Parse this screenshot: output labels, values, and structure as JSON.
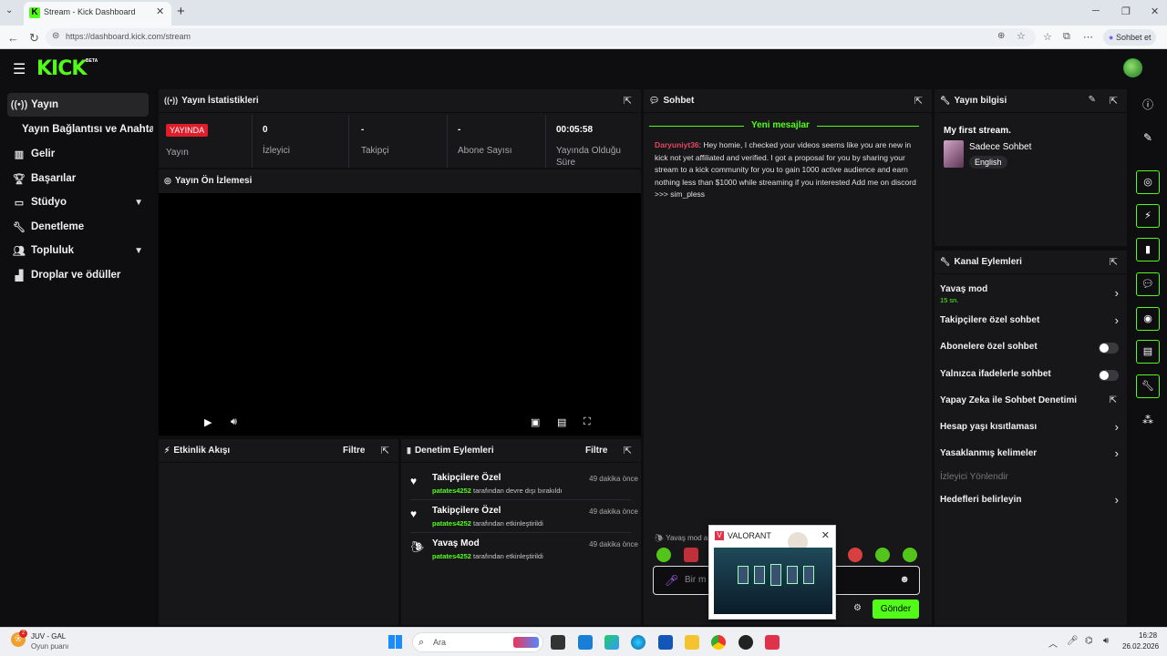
{
  "browser": {
    "tab_title": "Stream - Kick Dashboard",
    "url": "https://dashboard.kick.com/stream",
    "chat_button": "Sohbet et"
  },
  "header": {
    "logo": "KICK",
    "beta": "BETA"
  },
  "sidebar": {
    "items": [
      {
        "label": "Yayın",
        "icon": "broadcast-icon"
      },
      {
        "label": "Yayın Bağlantısı ve Anahtarı",
        "icon": ""
      },
      {
        "label": "Gelir",
        "icon": "chart-icon"
      },
      {
        "label": "Başarılar",
        "icon": "trophy-icon"
      },
      {
        "label": "Stüdyo",
        "icon": "studio-icon"
      },
      {
        "label": "Denetleme",
        "icon": "wrench-icon"
      },
      {
        "label": "Topluluk",
        "icon": "people-icon"
      },
      {
        "label": "Droplar ve ödüller",
        "icon": "gift-icon"
      }
    ]
  },
  "stats": {
    "title": "Yayın İstatistikleri",
    "live_badge": "YAYINDA",
    "cells": [
      {
        "value": "",
        "label": "Yayın"
      },
      {
        "value": "0",
        "label": "İzleyici"
      },
      {
        "value": "-",
        "label": "Takipçi"
      },
      {
        "value": "-",
        "label": "Abone Sayısı"
      },
      {
        "value": "00:05:58",
        "label": "Yayında Olduğu Süre"
      }
    ]
  },
  "preview": {
    "title": "Yayın Ön İzlemesi"
  },
  "activity": {
    "title": "Etkinlik Akışı",
    "filter": "Filtre"
  },
  "modactions": {
    "title": "Denetim Eylemleri",
    "filter": "Filtre",
    "items": [
      {
        "title": "Takipçilere Özel",
        "user": "patates4252",
        "desc": "tarafından devre dışı bırakıldı",
        "time": "49 dakika önce",
        "icon": "heart-icon"
      },
      {
        "title": "Takipçilere Özel",
        "user": "patates4252",
        "desc": "tarafından etkinleştirildi",
        "time": "49 dakika önce",
        "icon": "heart-icon"
      },
      {
        "title": "Yavaş Mod",
        "user": "patates4252",
        "desc": "tarafından etkinleştirildi",
        "time": "49 dakika önce",
        "icon": "snail-icon"
      }
    ]
  },
  "chat": {
    "title": "Sohbet",
    "new_messages": "Yeni mesajlar",
    "message_user": "Daryuniyt36",
    "message_text": ": Hey homie, I checked your videos seems like you are new in kick not yet affiliated and verified. I got a proposal for you by sharing your stream to a kick community for you to gain 1000 active audience and earn nothing less than $1000 while streaming if you interested Add me on discord >>> sim_pless",
    "slow_mode": "Yavaş mod a",
    "input_placeholder": "Bir m",
    "send": "Gönder"
  },
  "info": {
    "title": "Yayın bilgisi",
    "stream_title": "My first stream.",
    "category": "Sadece Sohbet",
    "language": "English"
  },
  "actions": {
    "title": "Kanal Eylemleri",
    "items": [
      {
        "label": "Yavaş mod",
        "sub": "15 sn.",
        "control": "chevron"
      },
      {
        "label": "Takipçilere özel sohbet",
        "sub": "",
        "control": "chevron"
      },
      {
        "label": "Abonelere özel sohbet",
        "sub": "",
        "control": "toggle"
      },
      {
        "label": "Yalnızca ifadelerle sohbet",
        "sub": "",
        "control": "toggle"
      },
      {
        "label": "Yapay Zeka ile Sohbet Denetimi",
        "sub": "",
        "control": "external"
      },
      {
        "label": "Hesap yaşı kısıtlaması",
        "sub": "",
        "control": "chevron"
      },
      {
        "label": "Yasaklanmış kelimeler",
        "sub": "",
        "control": "chevron"
      },
      {
        "label": "İzleyici Yönlendir",
        "sub": "",
        "control": "disabled"
      },
      {
        "label": "Hedefleri belirleyin",
        "sub": "",
        "control": "chevron"
      }
    ]
  },
  "popup": {
    "title": "VALORANT"
  },
  "taskbar": {
    "weather_count": "2",
    "weather_line1": "JUV - GAL",
    "weather_line2": "Oyun puanı",
    "search": "Ara",
    "time": "16:28",
    "date": "26.02.2026"
  },
  "colors": {
    "accent": "#53fc18",
    "live": "#e01e2b",
    "panel": "#17171a",
    "bg": "#0d0d0f"
  }
}
